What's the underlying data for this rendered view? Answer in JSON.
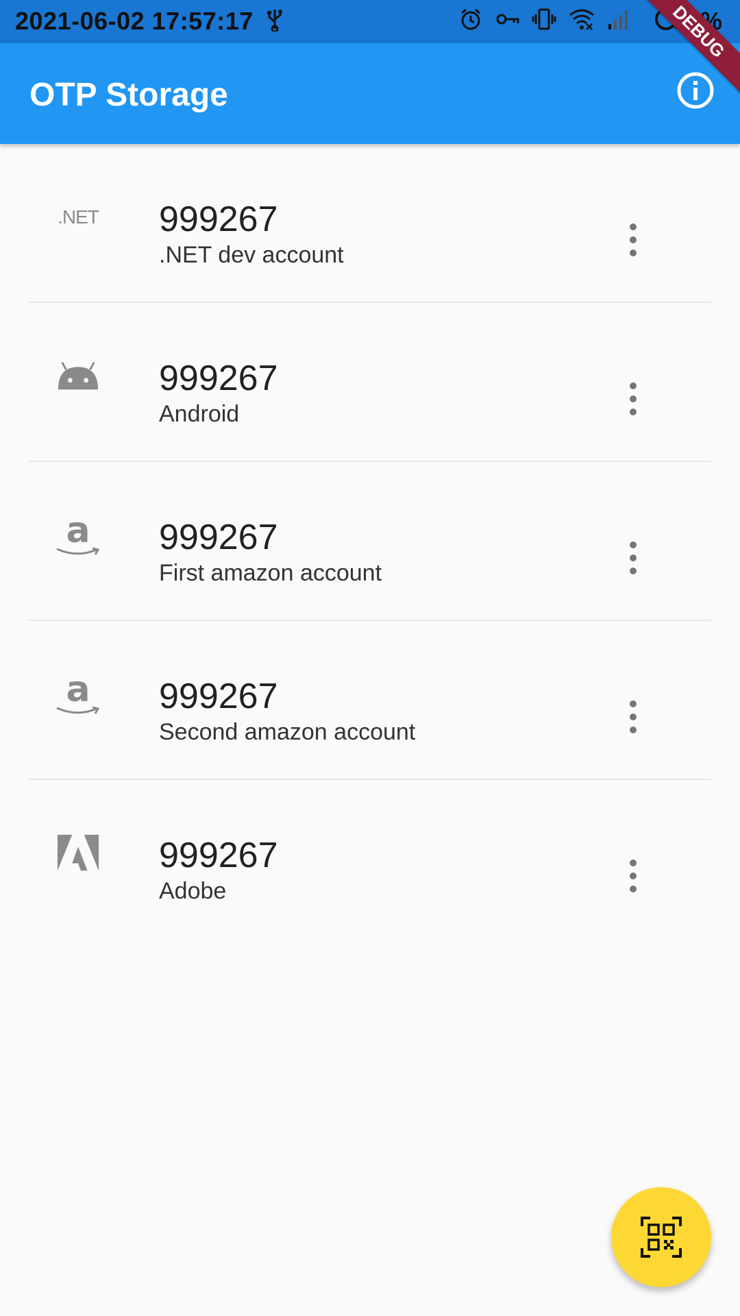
{
  "status_bar": {
    "time": "2021-06-02 17:57:17",
    "battery": "30%",
    "icons": [
      "usb-icon",
      "alarm-icon",
      "vpn-key-icon",
      "vibrate-icon",
      "wifi-icon",
      "signal-icon",
      "battery-icon"
    ]
  },
  "app_bar": {
    "title": "OTP Storage",
    "action_icon": "info-icon",
    "debug_banner": "DEBUG"
  },
  "accounts": [
    {
      "logo": "dotnet-logo",
      "logo_text": ".NET",
      "code": "999267",
      "name": ".NET dev account",
      "menu_icon": "more-vert-icon"
    },
    {
      "logo": "android-logo",
      "code": "999267",
      "name": "Android",
      "menu_icon": "more-vert-icon"
    },
    {
      "logo": "amazon-logo",
      "logo_text": "a",
      "code": "999267",
      "name": "First amazon account",
      "menu_icon": "more-vert-icon"
    },
    {
      "logo": "amazon-logo",
      "logo_text": "a",
      "code": "999267",
      "name": "Second amazon account",
      "menu_icon": "more-vert-icon"
    },
    {
      "logo": "adobe-logo",
      "code": "999267",
      "name": "Adobe",
      "menu_icon": "more-vert-icon"
    }
  ],
  "fab": {
    "icon": "qr-scan-icon"
  },
  "colors": {
    "status_bar": "#1976d2",
    "app_bar": "#2196f3",
    "fab": "#fdd835",
    "debug": "#8e1e3a",
    "logo_grey": "#8a8a8a"
  }
}
